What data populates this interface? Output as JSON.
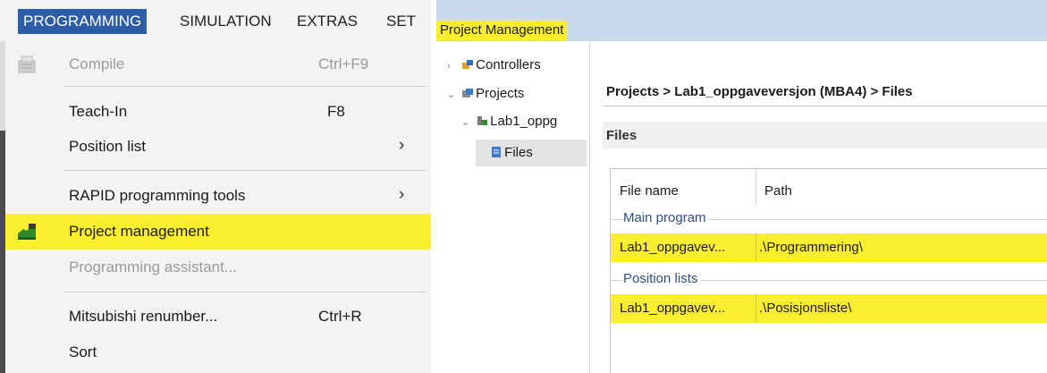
{
  "menubar": {
    "items": [
      "PROGRAMMING",
      "SIMULATION",
      "EXTRAS",
      "SET"
    ]
  },
  "menu": {
    "items": [
      {
        "label": "Compile",
        "shortcut": "Ctrl+F9",
        "disabled": true,
        "icon": "compile-icon"
      },
      {
        "label": "Teach-In",
        "shortcut": "F8"
      },
      {
        "label": "Position list",
        "submenu": "›"
      },
      {
        "label": "RAPID programming tools",
        "submenu": "›"
      },
      {
        "label": "Project management",
        "highlighted": true,
        "icon": "project-management-icon"
      },
      {
        "label": "Programming assistant...",
        "disabled": true
      },
      {
        "label": "Mitsubishi renumber...",
        "shortcut": "Ctrl+R"
      },
      {
        "label": "Sort"
      }
    ]
  },
  "panel": {
    "title": "Project Management",
    "tree": [
      {
        "label": "Controllers",
        "chevron": "›",
        "icon": "controllers-icon"
      },
      {
        "label": "Projects",
        "chevron": "⌄",
        "icon": "projects-icon"
      },
      {
        "label": "Lab1_oppg",
        "chevron": "⌄",
        "icon": "project-icon"
      },
      {
        "label": "Files",
        "icon": "files-icon",
        "selected": true
      }
    ],
    "breadcrumb": "Projects > Lab1_oppgaveversjon (MBA4) > Files",
    "section_title": "Files",
    "grid": {
      "columns": [
        "File name",
        "Path"
      ],
      "groups": [
        {
          "name": "Main program",
          "rows": [
            {
              "file": "Lab1_oppgavev...",
              "path": ".\\Programmering\\"
            }
          ]
        },
        {
          "name": "Position lists",
          "rows": [
            {
              "file": "Lab1_oppgavev...",
              "path": ".\\Posisjonsliste\\"
            }
          ]
        }
      ]
    }
  },
  "colors": {
    "highlight": "#fbee2f",
    "menu_active": "#2e5da8",
    "titlebar": "#c9d9ec",
    "group_text": "#2f4e8a"
  }
}
